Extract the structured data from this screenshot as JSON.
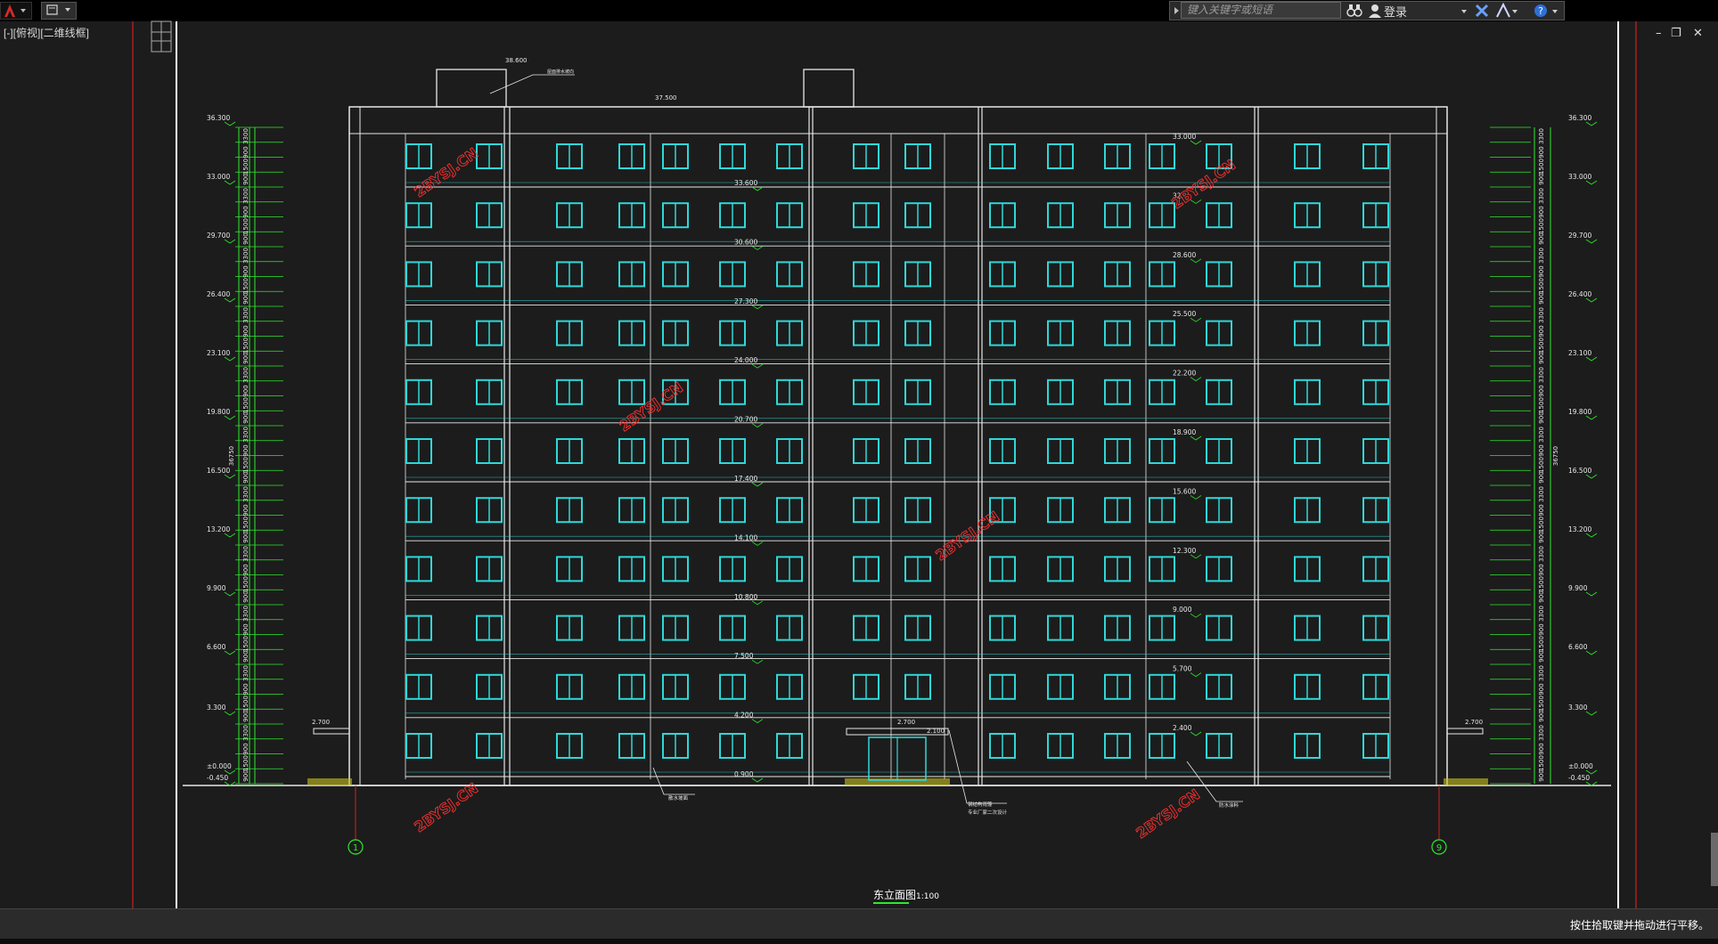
{
  "app": {
    "viewport_label": "[-][俯视][二维线框]",
    "search_placeholder": "键入关键字或短语",
    "login_label": "登录",
    "help_icon": "question-icon",
    "status_text": "按住拾取键并拖动进行平移。"
  },
  "drawing": {
    "title": "东立面图",
    "scale": "1:100",
    "watermark": "2BYSJ.CN",
    "axis_left": "1",
    "axis_right": "9",
    "roof_top": "38.600",
    "parapet": "37.500",
    "canopy_left": "2.700",
    "canopy_right": "2.700",
    "entrance_canopy": "2.700",
    "entrance_sill": "2.100",
    "left_total": "36750",
    "right_total": "36750",
    "elevations_left": [
      "36.300",
      "33.000",
      "29.700",
      "26.400",
      "23.100",
      "19.800",
      "16.500",
      "13.200",
      "9.900",
      "6.600",
      "3.300",
      "±0.000",
      "-0.450"
    ],
    "elevations_right": [
      "36.300",
      "33.000",
      "29.700",
      "26.400",
      "23.100",
      "19.800",
      "16.500",
      "13.200",
      "9.900",
      "6.600",
      "3.300",
      "±0.000",
      "-0.450"
    ],
    "center_levels": [
      "33.600",
      "30.600",
      "27.300",
      "24.000",
      "20.700",
      "17.400",
      "14.100",
      "10.800",
      "7.500",
      "4.200",
      "0.900"
    ],
    "right_levels": [
      "33.000",
      "32.",
      "28.600",
      "25.500",
      "22.200",
      "18.900",
      "15.600",
      "12.300",
      "9.000",
      "5.700",
      "2.400"
    ],
    "floor_dim": [
      "3300",
      "900",
      "1500",
      "900"
    ],
    "notes": {
      "roof_note": "屋面排水坡向",
      "bottom_left_note": "散水坡面",
      "bottom_center_note_1": "钢结构雨篷",
      "bottom_center_note_2": "专业厂家二次设计",
      "bottom_right_note": "防水涂料"
    }
  }
}
